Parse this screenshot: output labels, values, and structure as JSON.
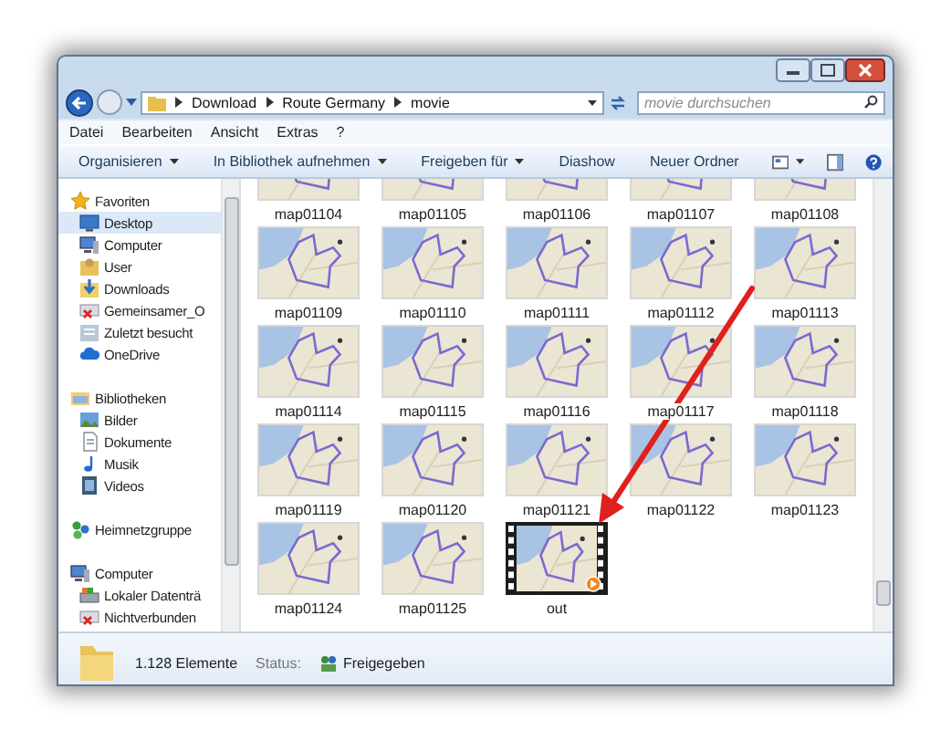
{
  "address": {
    "crumbs": [
      "Download",
      "Route Germany",
      "movie"
    ]
  },
  "search": {
    "placeholder": "movie durchsuchen"
  },
  "menu": [
    "Datei",
    "Bearbeiten",
    "Ansicht",
    "Extras",
    "?"
  ],
  "toolbar": [
    {
      "label": "Organisieren",
      "dropdown": true
    },
    {
      "label": "In Bibliothek aufnehmen",
      "dropdown": true
    },
    {
      "label": "Freigeben für",
      "dropdown": true
    },
    {
      "label": "Diashow",
      "dropdown": false
    },
    {
      "label": "Neuer Ordner",
      "dropdown": false
    }
  ],
  "sidebar": {
    "groups": [
      {
        "label": "Favoriten",
        "kind": "star",
        "selected": false,
        "children": [
          {
            "label": "Desktop",
            "kind": "desktop",
            "selected": true
          },
          {
            "label": "Computer",
            "kind": "computer",
            "selected": false
          },
          {
            "label": "User",
            "kind": "user",
            "selected": false
          },
          {
            "label": "Downloads",
            "kind": "downloads",
            "selected": false
          },
          {
            "label": "Gemeinsamer_O",
            "kind": "netdrive",
            "selected": false
          },
          {
            "label": "Zuletzt besucht",
            "kind": "recent",
            "selected": false
          },
          {
            "label": "OneDrive",
            "kind": "cloud",
            "selected": false
          }
        ]
      },
      {
        "label": "Bibliotheken",
        "kind": "library",
        "selected": false,
        "children": [
          {
            "label": "Bilder",
            "kind": "pictures",
            "selected": false
          },
          {
            "label": "Dokumente",
            "kind": "documents",
            "selected": false
          },
          {
            "label": "Musik",
            "kind": "music",
            "selected": false
          },
          {
            "label": "Videos",
            "kind": "videos",
            "selected": false
          }
        ]
      },
      {
        "label": "Heimnetzgruppe",
        "kind": "homegroup",
        "selected": false
      },
      {
        "label": "Computer",
        "kind": "computer",
        "selected": false,
        "children": [
          {
            "label": "Lokaler Datenträ",
            "kind": "disk",
            "selected": false
          },
          {
            "label": "Nichtverbunden",
            "kind": "netdrive",
            "selected": false
          }
        ]
      }
    ]
  },
  "files": [
    {
      "name": "map01104",
      "kind": "image"
    },
    {
      "name": "map01105",
      "kind": "image"
    },
    {
      "name": "map01106",
      "kind": "image"
    },
    {
      "name": "map01107",
      "kind": "image"
    },
    {
      "name": "map01108",
      "kind": "image"
    },
    {
      "name": "map01109",
      "kind": "image"
    },
    {
      "name": "map01110",
      "kind": "image"
    },
    {
      "name": "map01111",
      "kind": "image"
    },
    {
      "name": "map01112",
      "kind": "image"
    },
    {
      "name": "map01113",
      "kind": "image"
    },
    {
      "name": "map01114",
      "kind": "image"
    },
    {
      "name": "map01115",
      "kind": "image"
    },
    {
      "name": "map01116",
      "kind": "image"
    },
    {
      "name": "map01117",
      "kind": "image"
    },
    {
      "name": "map01118",
      "kind": "image"
    },
    {
      "name": "map01119",
      "kind": "image"
    },
    {
      "name": "map01120",
      "kind": "image"
    },
    {
      "name": "map01121",
      "kind": "image"
    },
    {
      "name": "map01122",
      "kind": "image"
    },
    {
      "name": "map01123",
      "kind": "image"
    },
    {
      "name": "map01124",
      "kind": "image"
    },
    {
      "name": "map01125",
      "kind": "image"
    },
    {
      "name": "out",
      "kind": "video"
    }
  ],
  "status": {
    "count": "1.128 Elemente",
    "label": "Status:",
    "value": "Freigegeben"
  }
}
